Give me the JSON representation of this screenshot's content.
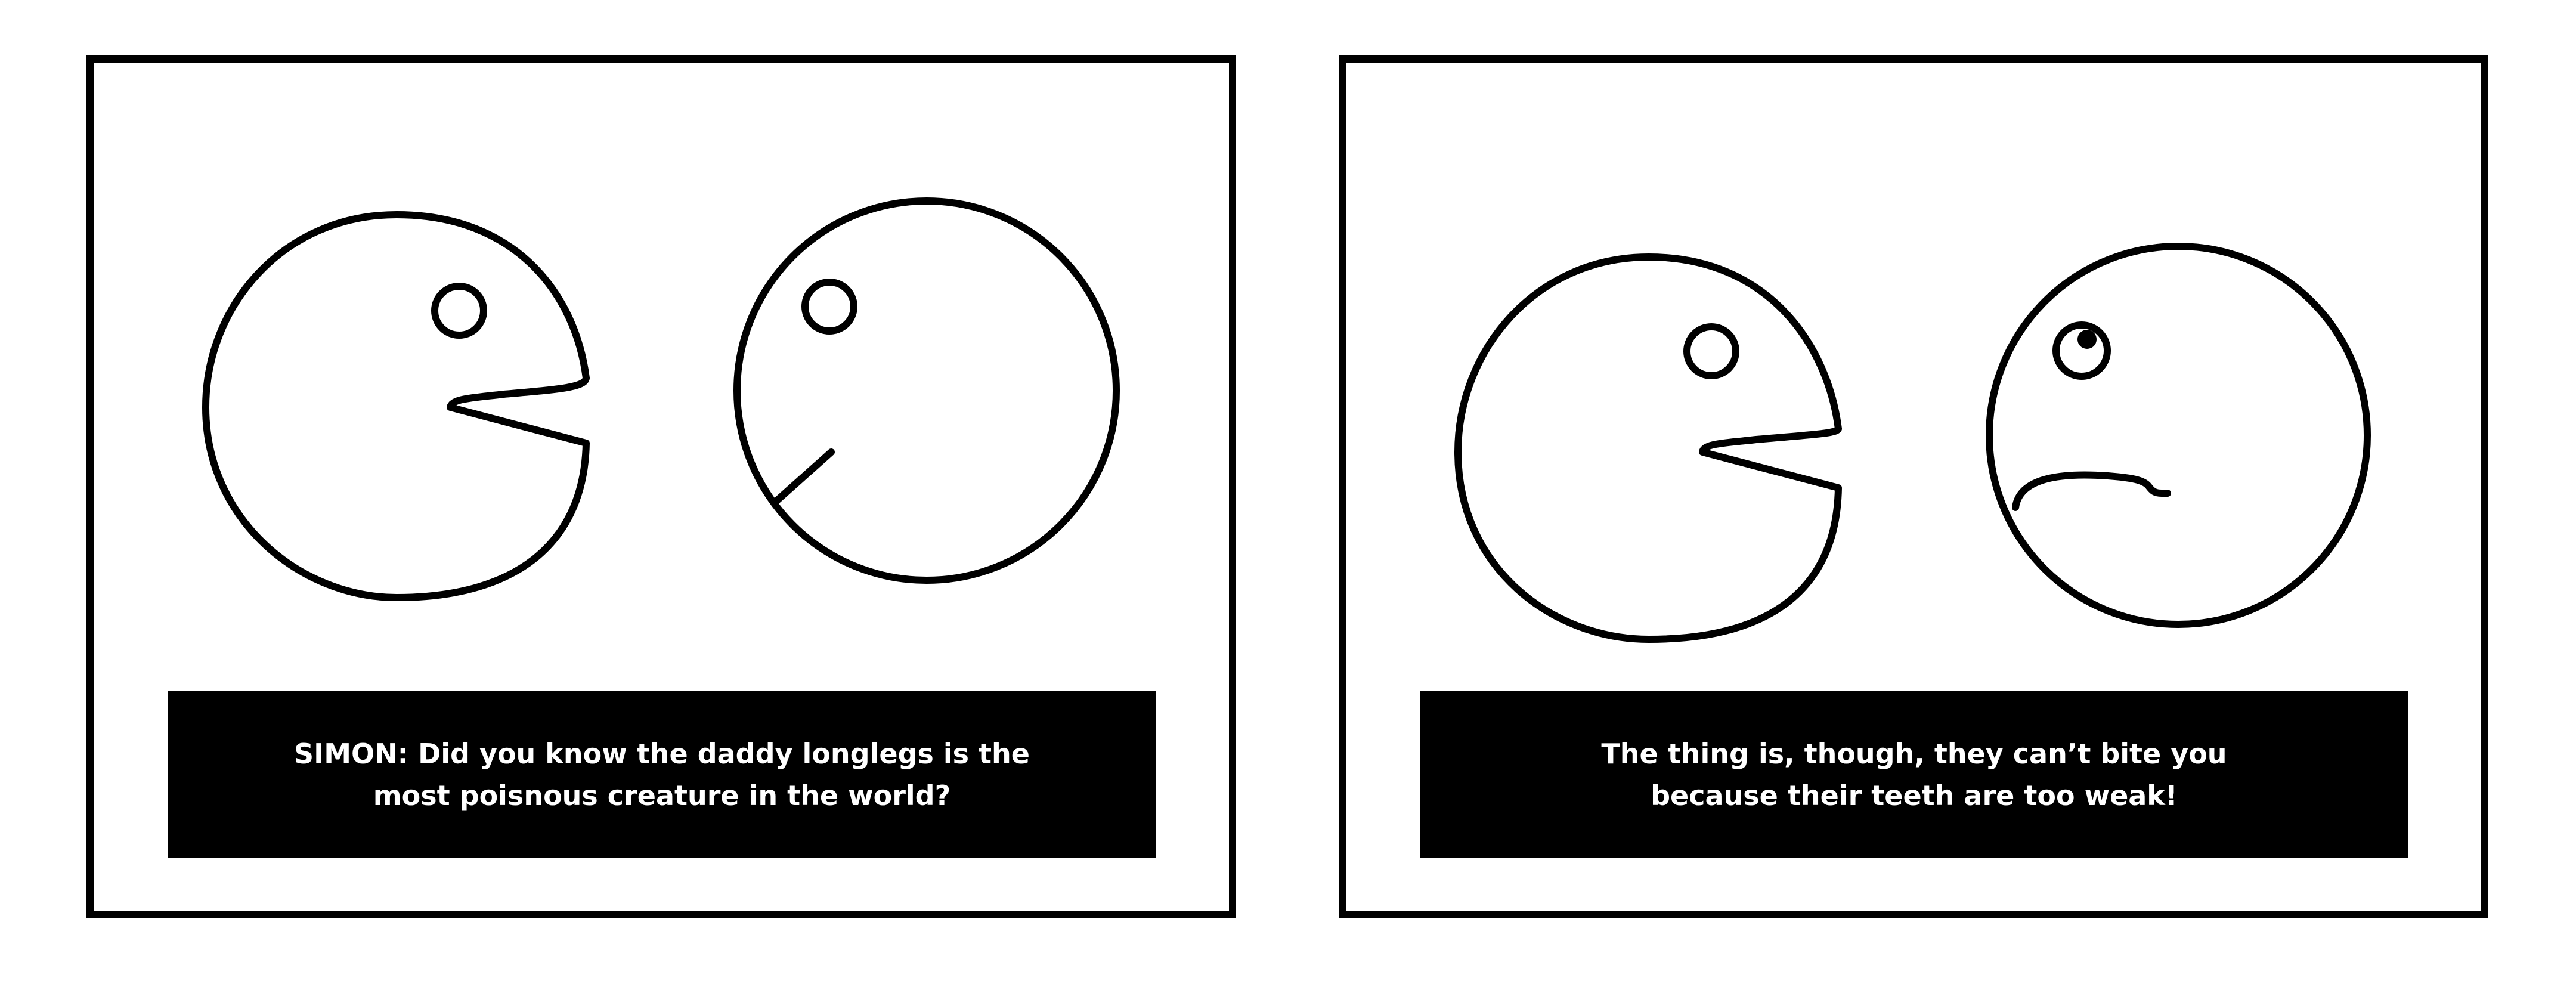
{
  "panels": [
    {
      "caption_lines": [
        "SIMON: Did you know the daddy longlegs is the",
        "most poisnous creature in the world?"
      ]
    },
    {
      "caption_lines": [
        "The thing is, though, they can’t bite you",
        "because their teeth are too weak!"
      ]
    }
  ],
  "colors": {
    "ink": "#000000",
    "paper": "#ffffff"
  }
}
